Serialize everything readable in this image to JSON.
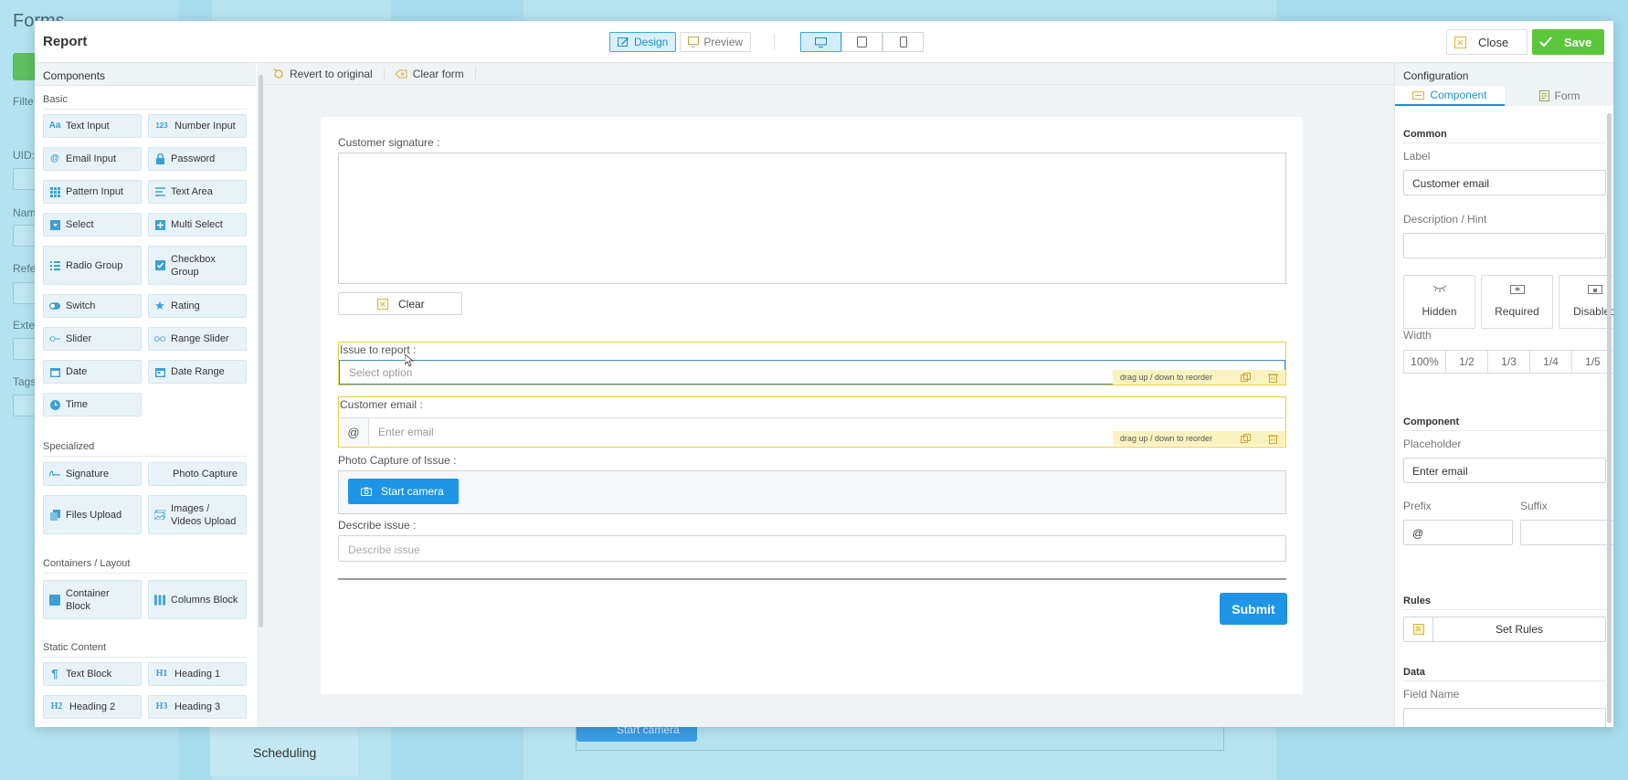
{
  "background": {
    "title": "Forms",
    "filter_label": "Filte",
    "uid_label": "UID:",
    "name_label": "Nam",
    "ref_label": "Refe",
    "ext_label": "Exte",
    "tags_label": "Tags",
    "tab_label": "Scheduling",
    "camera_label": "Start camera"
  },
  "modal": {
    "title": "Report",
    "design_label": "Design",
    "preview_label": "Preview",
    "close_label": "Close",
    "save_label": "Save"
  },
  "components": {
    "header": "Components",
    "sections": {
      "basic": "Basic",
      "specialized": "Specialized",
      "containers": "Containers / Layout",
      "static": "Static Content"
    },
    "items": {
      "text_input": "Text Input",
      "number_input": "Number Input",
      "email_input": "Email Input",
      "password": "Password",
      "pattern_input": "Pattern Input",
      "text_area": "Text Area",
      "select": "Select",
      "multi_select": "Multi Select",
      "radio_group": "Radio Group",
      "checkbox_group": "Checkbox Group",
      "switch": "Switch",
      "rating": "Rating",
      "slider": "Slider",
      "range_slider": "Range Slider",
      "date": "Date",
      "date_range": "Date Range",
      "time": "Time",
      "signature": "Signature",
      "photo_capture": "Photo Capture",
      "files_upload": "Files Upload",
      "images_videos_upload": "Images / Videos Upload",
      "container_block": "Container Block",
      "columns_block": "Columns Block",
      "text_block": "Text Block",
      "heading_1": "Heading 1",
      "heading_2": "Heading 2",
      "heading_3": "Heading 3"
    },
    "icon_text": {
      "number": "123",
      "h1": "H1",
      "h2": "H2",
      "h3": "H3",
      "aa": "Aa"
    }
  },
  "toolbar": {
    "revert_label": "Revert to original",
    "clear_form_label": "Clear form"
  },
  "form": {
    "signature_label": "Customer signature :",
    "clear_label": "Clear",
    "issue_label": "Issue to report :",
    "issue_placeholder": "Select option",
    "drag_hint": "drag up / down to reorder",
    "email_label": "Customer email :",
    "email_prefix": "@",
    "email_placeholder": "Enter email",
    "photo_label": "Photo Capture of Issue :",
    "camera_label": "Start camera",
    "describe_label": "Describe issue :",
    "describe_placeholder": "Describe issue",
    "submit_label": "Submit"
  },
  "config": {
    "header": "Configuration",
    "tab_component": "Component",
    "tab_form": "Form",
    "common_section": "Common",
    "label_label": "Label",
    "label_value": "Customer email",
    "desc_label": "Description / Hint",
    "desc_value": "",
    "hidden_label": "Hidden",
    "required_label": "Required",
    "disabled_label": "Disabled",
    "width_label": "Width",
    "widths": [
      "100%",
      "1/2",
      "1/3",
      "1/4",
      "1/5"
    ],
    "component_section": "Component",
    "placeholder_label": "Placeholder",
    "placeholder_value": "Enter email",
    "prefix_label": "Prefix",
    "prefix_value": "@",
    "suffix_label": "Suffix",
    "suffix_value": "",
    "rules_section": "Rules",
    "set_rules_label": "Set Rules",
    "data_section": "Data",
    "field_name_label": "Field Name"
  },
  "colors": {
    "accent": "#1e95e6",
    "save": "#5cc63a",
    "highlight": "#e9cf3e"
  }
}
